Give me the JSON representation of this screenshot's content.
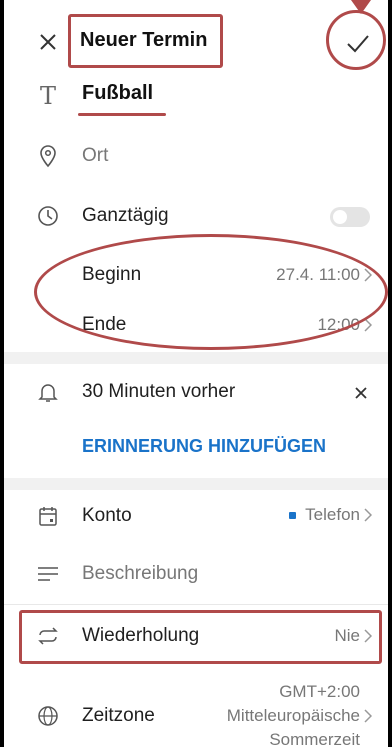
{
  "header": {
    "title": "Neuer Termin"
  },
  "event": {
    "title": "Fußball"
  },
  "location": {
    "placeholder": "Ort"
  },
  "allday": {
    "label": "Ganztägig"
  },
  "start": {
    "label": "Beginn",
    "value": "27.4. 11:00"
  },
  "end": {
    "label": "Ende",
    "value": "12:00"
  },
  "reminder": {
    "label": "30 Minuten vorher",
    "add_label": "ERINNERUNG HINZUFÜGEN"
  },
  "account": {
    "label": "Konto",
    "value": "Telefon"
  },
  "description": {
    "placeholder": "Beschreibung"
  },
  "repeat": {
    "label": "Wiederholung",
    "value": "Nie"
  },
  "timezone": {
    "label": "Zeitzone",
    "value_line1": "GMT+2:00",
    "value_line2": "Mitteleuropäische",
    "value_line3": "Sommerzeit"
  },
  "colors": {
    "accent": "#1a73c9",
    "annotation": "#b04a4a"
  }
}
